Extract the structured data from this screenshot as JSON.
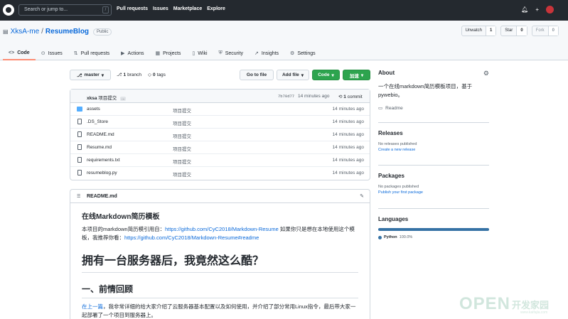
{
  "topbar": {
    "search_placeholder": "Search or jump to...",
    "search_key": "/",
    "nav": [
      "Pull requests",
      "Issues",
      "Marketplace",
      "Explore"
    ],
    "plus_label": "+"
  },
  "repo": {
    "owner": "XksA-me",
    "separator": "/",
    "name": "ResumeBlog",
    "visibility": "Public",
    "unwatch_label": "Unwatch",
    "unwatch_count": "1",
    "star_label": "Star",
    "star_count": "0",
    "fork_label": "Fork",
    "fork_count": "0"
  },
  "tabs": [
    {
      "label": "Code",
      "icon": "<>"
    },
    {
      "label": "Issues",
      "icon": "⊙"
    },
    {
      "label": "Pull requests",
      "icon": "⇅"
    },
    {
      "label": "Actions",
      "icon": "▶"
    },
    {
      "label": "Projects",
      "icon": "▦"
    },
    {
      "label": "Wiki",
      "icon": "▯"
    },
    {
      "label": "Security",
      "icon": "⛨"
    },
    {
      "label": "Insights",
      "icon": "↗"
    },
    {
      "label": "Settings",
      "icon": "⚙"
    }
  ],
  "toolbar": {
    "branch": "master",
    "branch_count": "1",
    "branch_label": "branch",
    "tags_count": "0",
    "tags_label": "tags",
    "goto_file": "Go to file",
    "add_file": "Add file",
    "code": "Code",
    "accelerate": "加速"
  },
  "commit": {
    "author": "xksa",
    "message": "项目提交",
    "dots": "...",
    "hash": "7b70d77",
    "time": "14 minutes ago",
    "count": "1",
    "count_label": "commit"
  },
  "files": [
    {
      "name": "assets",
      "type": "folder",
      "message": "项目提交",
      "time": "14 minutes ago"
    },
    {
      "name": ".DS_Store",
      "type": "file",
      "message": "项目提交",
      "time": "14 minutes ago"
    },
    {
      "name": "README.md",
      "type": "file",
      "message": "项目提交",
      "time": "14 minutes ago"
    },
    {
      "name": "Resume.md",
      "type": "file",
      "message": "项目提交",
      "time": "14 minutes ago"
    },
    {
      "name": "requirements.txt",
      "type": "file",
      "message": "项目提交",
      "time": "14 minutes ago"
    },
    {
      "name": "resumeblog.py",
      "type": "file",
      "message": "项目提交",
      "time": "14 minutes ago"
    }
  ],
  "readme": {
    "title": "README.md",
    "h3": "在线Markdown简历模板",
    "p1_prefix": "本项目的markdown简历模引用自：",
    "p1_link": "https://github.com/CyC2018/Markdown-Resume",
    "p1_suffix": " 如果你只是想在本地使用这个模板，我推荐你看：",
    "p1_link2": "https://github.com/CyC2018/Markdown-Resume#readme",
    "h1": "拥有一台服务器后，我竟然这么酷？",
    "h2": "一、前情回顾",
    "p2_link": "在上一篇",
    "p2_text": "，我非常详细的给大家介绍了云服务器基本配置以及如何使用，并介绍了部分常用Linux指令，最后带大家一起部署了一个项目到服务器上。"
  },
  "about": {
    "title": "About",
    "description": "一个在线markdown简历模板项目，基于pywebio。",
    "readme_link": "Readme"
  },
  "releases": {
    "title": "Releases",
    "empty": "No releases published",
    "link": "Create a new release"
  },
  "packages": {
    "title": "Packages",
    "empty": "No packages published",
    "link": "Publish your first package"
  },
  "languages": {
    "title": "Languages",
    "name": "Python",
    "percent": "100.0%",
    "color": "#3572a5"
  },
  "watermark": {
    "text": "OPEN",
    "cn": "开发家园",
    "url": "www.kaifajia.com"
  }
}
